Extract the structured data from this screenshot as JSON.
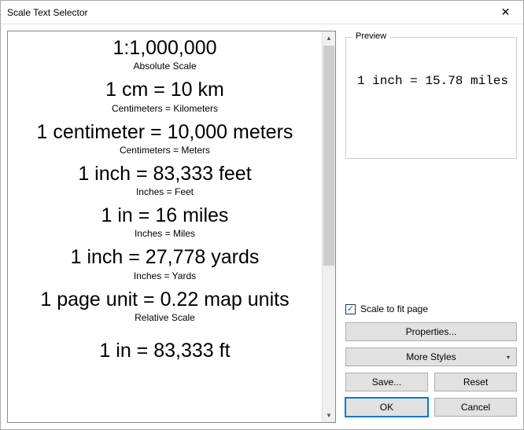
{
  "window": {
    "title": "Scale Text Selector",
    "close_glyph": "✕"
  },
  "styles": [
    {
      "main": "1:1,000,000",
      "sub": "Absolute Scale"
    },
    {
      "main": "1 cm = 10 km",
      "sub": "Centimeters = Kilometers"
    },
    {
      "main": "1 centimeter = 10,000 meters",
      "sub": "Centimeters = Meters"
    },
    {
      "main": "1 inch = 83,333 feet",
      "sub": "Inches = Feet"
    },
    {
      "main": "1 in = 16 miles",
      "sub": "Inches = Miles"
    },
    {
      "main": "1 inch = 27,778 yards",
      "sub": "Inches = Yards"
    },
    {
      "main": "1 page unit = 0.22 map units",
      "sub": "Relative Scale"
    },
    {
      "main": "1 in = 83,333 ft",
      "sub": ""
    }
  ],
  "preview": {
    "legend": "Preview",
    "text": "1 inch = 15.78 miles"
  },
  "checkbox": {
    "label": "Scale to fit page",
    "checked": "✓"
  },
  "buttons": {
    "properties": "Properties...",
    "more_styles": "More Styles",
    "save": "Save...",
    "reset": "Reset",
    "ok": "OK",
    "cancel": "Cancel"
  },
  "scrollbar": {
    "up": "▲",
    "down": "▼"
  }
}
